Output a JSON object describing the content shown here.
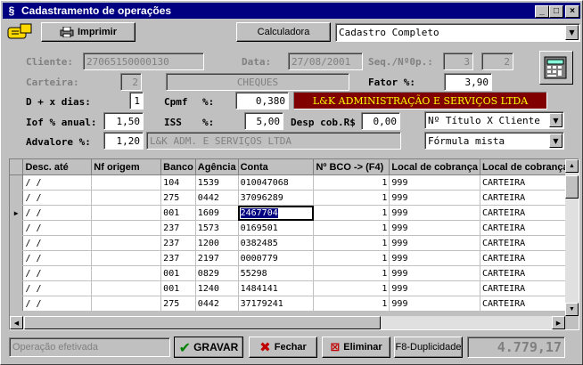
{
  "window": {
    "title": "Cadastramento de operações",
    "min": "_",
    "max": "□",
    "close": "×"
  },
  "toolbar": {
    "print_label": "Imprimir",
    "calc_label": "Calculadora",
    "mode": "Cadastro Completo"
  },
  "form": {
    "cliente_label": "Cliente:",
    "cliente_value": "27065150000130",
    "data_label": "Data:",
    "data_value": "27/08/2001",
    "seq_label": "Seq./Nº0p.:",
    "seq_value": "3",
    "nop_value": "2",
    "carteira_label": "Carteira:",
    "carteira_value": "2",
    "carteira_name": "CHEQUES",
    "fator_label": "Fator %:",
    "fator_value": "3,90",
    "dias_label": "D + x dias:",
    "dias_value": "1",
    "cpmf_label": "Cpmf",
    "cpmf_pct": "%:",
    "cpmf_value": "0,380",
    "empresa_banner": "L&K ADMINISTRAÇÃO E SERVIÇOS LTDA",
    "iof_label": "Iof % anual:",
    "iof_value": "1,50",
    "iss_label": "ISS",
    "iss_pct": "%:",
    "iss_value": "5,00",
    "desp_label": "Desp cob.R$",
    "desp_value": "0,00",
    "titulo_combo": "Nº Título X Cliente",
    "advalore_label": "Advalore %:",
    "advalore_value": "1,20",
    "cliente_nome": "L&K ADM. E SERVIÇOS LTDA",
    "formula_combo": "Fórmula mista"
  },
  "grid": {
    "columns": [
      "Desc. até",
      "Nf origem",
      "Banco",
      "Agência",
      "Conta",
      "Nº BCO -> (F4)",
      "Local de cobrança",
      "Local de cobrança"
    ],
    "rows": [
      [
        "/  /",
        "",
        "104",
        "1539",
        "010047068",
        "1",
        "999",
        "CARTEIRA"
      ],
      [
        "/  /",
        "",
        "275",
        "0442",
        "37096289",
        "1",
        "999",
        "CARTEIRA"
      ],
      [
        "/  /",
        "",
        "001",
        "1609",
        "2467704",
        "1",
        "999",
        "CARTEIRA"
      ],
      [
        "/  /",
        "",
        "237",
        "1573",
        "0169501",
        "1",
        "999",
        "CARTEIRA"
      ],
      [
        "/  /",
        "",
        "237",
        "1200",
        "0382485",
        "1",
        "999",
        "CARTEIRA"
      ],
      [
        "/  /",
        "",
        "237",
        "2197",
        "0000779",
        "1",
        "999",
        "CARTEIRA"
      ],
      [
        "/  /",
        "",
        "001",
        "0829",
        "55298",
        "1",
        "999",
        "CARTEIRA"
      ],
      [
        "/  /",
        "",
        "001",
        "1240",
        "1484141",
        "1",
        "999",
        "CARTEIRA"
      ],
      [
        "/  /",
        "",
        "275",
        "0442",
        "37179241",
        "1",
        "999",
        "CARTEIRA"
      ]
    ]
  },
  "footer": {
    "status": "Operação efetivada",
    "gravar": "GRAVAR",
    "fechar": "Fechar",
    "eliminar": "Eliminar",
    "duplicidade": "F8-Duplicidade",
    "total": "4.779,17"
  }
}
